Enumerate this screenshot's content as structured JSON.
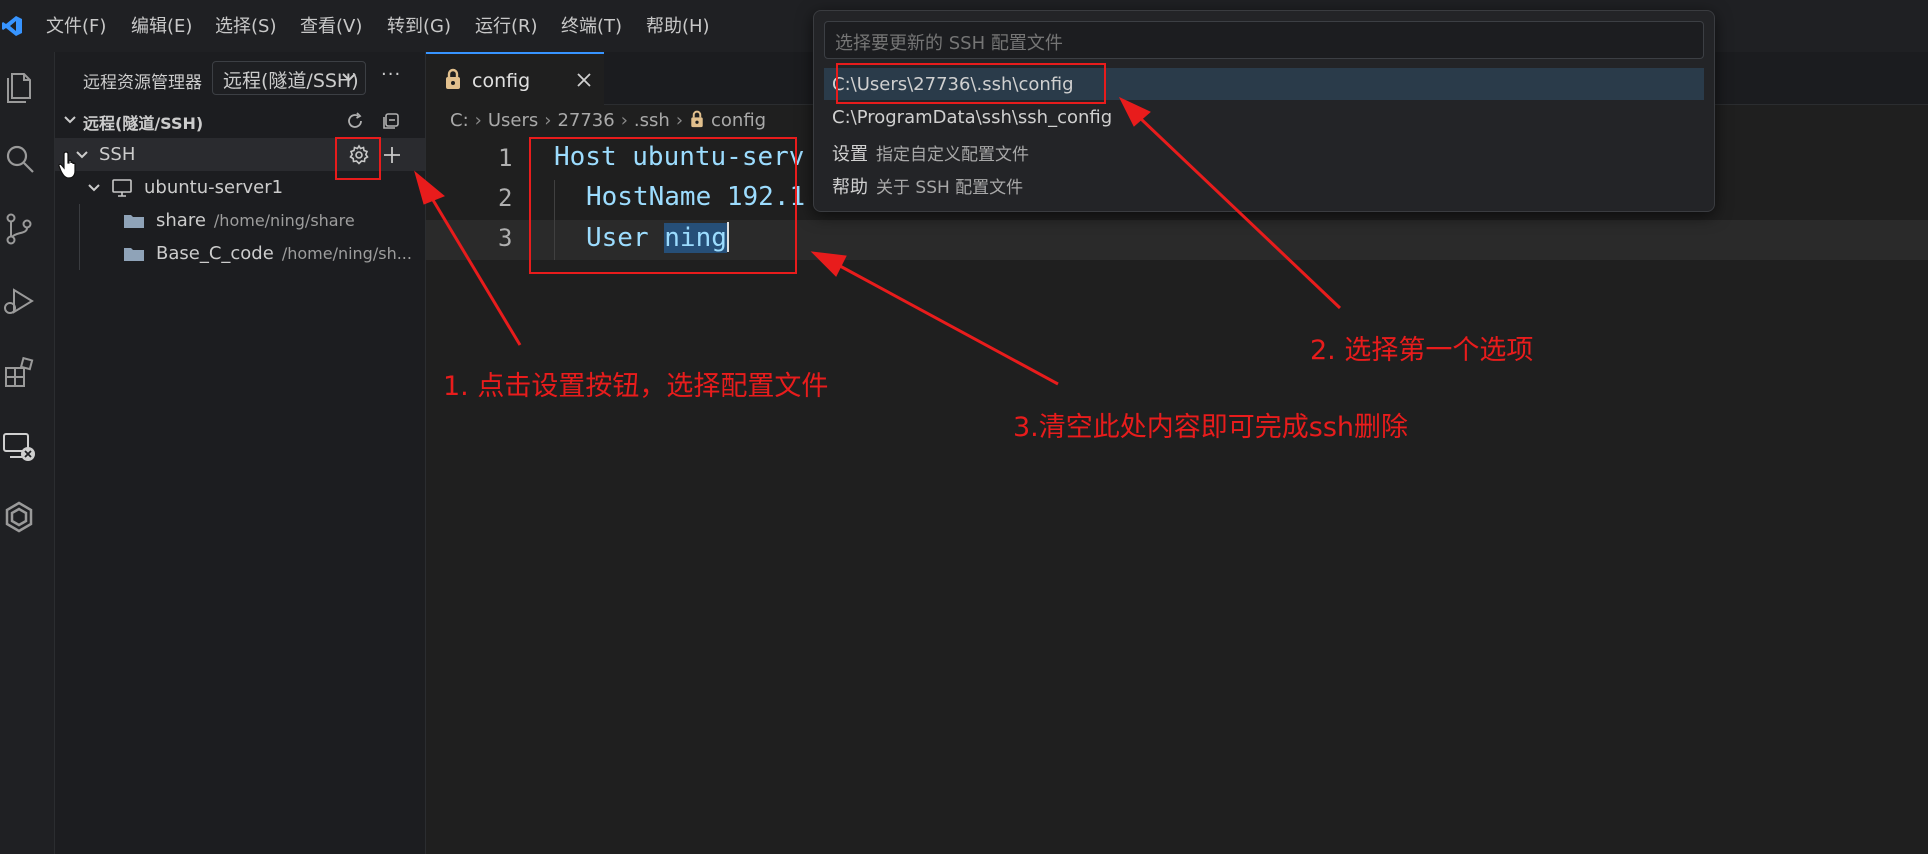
{
  "menubar": {
    "items": [
      "文件(F)",
      "编辑(E)",
      "选择(S)",
      "查看(V)",
      "转到(G)",
      "运行(R)",
      "终端(T)",
      "帮助(H)"
    ]
  },
  "activity_bar": {
    "icons": [
      "files-icon",
      "search-icon",
      "source-control-icon",
      "run-debug-icon",
      "extensions-icon",
      "remote-explorer-icon",
      "hexagon-icon"
    ]
  },
  "sidebar": {
    "title": "远程资源管理器",
    "select_value": "远程(隧道/SSH)",
    "more": "···",
    "section_title": "远程(隧道/SSH)",
    "ssh_label": "SSH",
    "server_label": "ubuntu-server1",
    "folders": [
      {
        "name": "share",
        "path": "/home/ning/share"
      },
      {
        "name": "Base_C_code",
        "path": "/home/ning/sh..."
      }
    ]
  },
  "editor": {
    "tab_label": "config",
    "breadcrumb": [
      "C:",
      "Users",
      "27736",
      ".ssh",
      "config"
    ],
    "lines": [
      {
        "no": "1",
        "text": "Host ubuntu-serv"
      },
      {
        "no": "2",
        "text": "HostName 192.1"
      },
      {
        "no": "3",
        "text_before": "User ",
        "text_selected": "ning"
      }
    ]
  },
  "quick_pick": {
    "placeholder": "选择要更新的 SSH 配置文件",
    "items": [
      {
        "label": "C:\\Users\\27736\\.ssh\\config",
        "desc": ""
      },
      {
        "label": "C:\\ProgramData\\ssh\\ssh_config",
        "desc": ""
      },
      {
        "label": "设置",
        "desc": "指定自定义配置文件"
      },
      {
        "label": "帮助",
        "desc": "关于 SSH 配置文件"
      }
    ]
  },
  "annotations": {
    "step1": "1. 点击设置按钮，选择配置文件",
    "step2": "2. 选择第一个选项",
    "step3": "3.清空此处内容即可完成ssh删除",
    "color": "#e81c1c"
  },
  "colors": {
    "accent": "#3794ff",
    "selection": "#264f78",
    "annotation": "#e81c1c"
  }
}
